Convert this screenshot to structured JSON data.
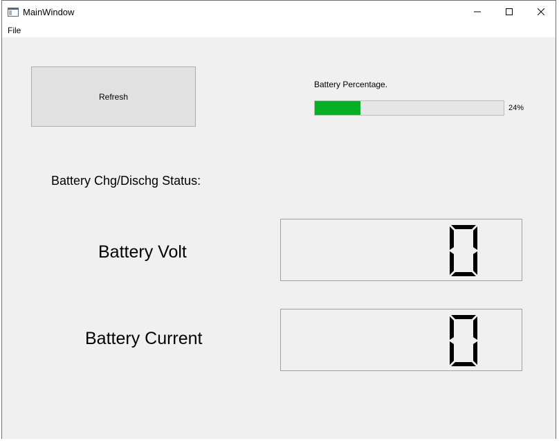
{
  "window": {
    "title": "MainWindow"
  },
  "menu": {
    "file_label": "File"
  },
  "controls": {
    "refresh_label": "Refresh",
    "battery_percentage_label": "Battery Percentage.",
    "battery_percentage_value": 24,
    "battery_percentage_text": "24%",
    "status_label": "Battery Chg/Dischg Status:",
    "volt_label": "Battery Volt",
    "current_label": "Battery Current"
  },
  "displays": {
    "volt_value": "0",
    "current_value": "0"
  },
  "colors": {
    "progress_fill": "#06b025",
    "window_bg": "#f0f0f0"
  },
  "icons": {
    "app": "window-app-icon",
    "minimize": "minimize-icon",
    "maximize": "maximize-icon",
    "close": "close-icon"
  }
}
